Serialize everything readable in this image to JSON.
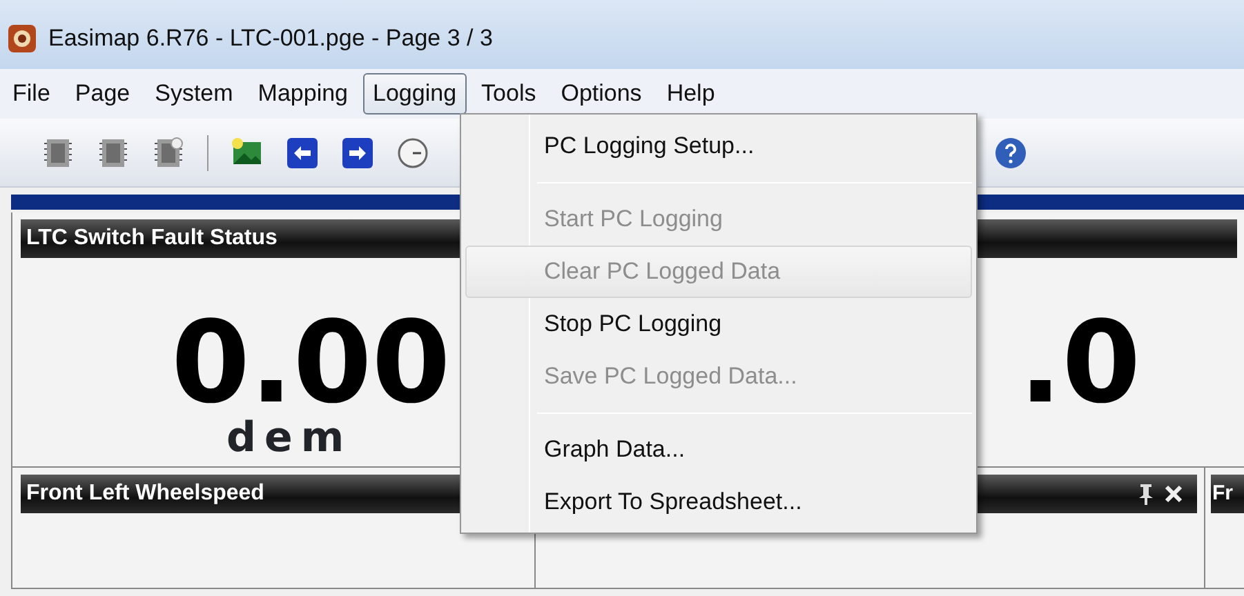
{
  "window": {
    "title": "Easimap 6.R76 - LTC-001.pge - Page 3 / 3"
  },
  "menu_bar": [
    {
      "label": "File",
      "selected": false
    },
    {
      "label": "Page",
      "selected": false
    },
    {
      "label": "System",
      "selected": false
    },
    {
      "label": "Mapping",
      "selected": false
    },
    {
      "label": "Logging",
      "selected": true
    },
    {
      "label": "Tools",
      "selected": false
    },
    {
      "label": "Options",
      "selected": false
    },
    {
      "label": "Help",
      "selected": false
    }
  ],
  "logging_menu": [
    {
      "kind": "item",
      "label": "PC Logging Setup...",
      "disabled": false,
      "selected": false
    },
    {
      "kind": "separator"
    },
    {
      "kind": "item",
      "label": "Start PC Logging",
      "disabled": true,
      "selected": false
    },
    {
      "kind": "item",
      "label": "Clear PC Logged Data",
      "disabled": true,
      "selected": true
    },
    {
      "kind": "item",
      "label": "Stop PC Logging",
      "disabled": false,
      "selected": false
    },
    {
      "kind": "item",
      "label": "Save PC Logged Data...",
      "disabled": true,
      "selected": false
    },
    {
      "kind": "separator"
    },
    {
      "kind": "item",
      "label": "Graph Data...",
      "disabled": false,
      "selected": false
    },
    {
      "kind": "item",
      "label": "Export To Spreadsheet...",
      "disabled": false,
      "selected": false
    }
  ],
  "panel_rows": [
    [
      {
        "title": "LTC Switch Fault Status",
        "value": "0.00",
        "units": "dem"
      },
      {
        "value": ".0"
      }
    ],
    [
      {
        "title": "Front Left Wheelspeed"
      },
      {
        "controls": true
      },
      {
        "title": "Fr"
      }
    ]
  ]
}
